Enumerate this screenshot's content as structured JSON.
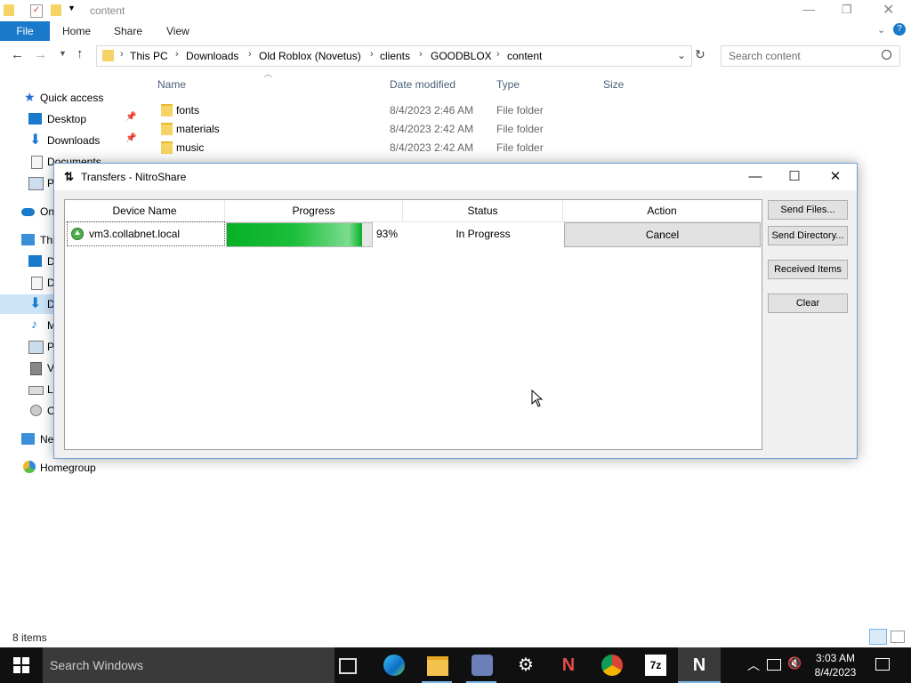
{
  "explorer": {
    "title": "content",
    "ribbon_tabs": [
      "File",
      "Home",
      "Share",
      "View"
    ],
    "breadcrumb": [
      "This PC",
      "Downloads",
      "Old Roblox (Novetus)",
      "clients",
      "GOODBLOX",
      "content"
    ],
    "search_placeholder": "Search content",
    "columns": {
      "name": "Name",
      "date": "Date modified",
      "type": "Type",
      "size": "Size"
    },
    "files": [
      {
        "name": "fonts",
        "date": "8/4/2023 2:46 AM",
        "type": "File folder"
      },
      {
        "name": "materials",
        "date": "8/4/2023 2:42 AM",
        "type": "File folder"
      },
      {
        "name": "music",
        "date": "8/4/2023 2:42 AM",
        "type": "File folder"
      }
    ],
    "nav": {
      "quick_access": "Quick access",
      "desktop": "Desktop",
      "downloads": "Downloads",
      "documents": "Documents",
      "pictures": "P",
      "onedrive": "On",
      "thispc": "Thi",
      "d1": "D",
      "d2": "D",
      "d3": "D",
      "music": "M",
      "pics2": "P",
      "videos": "V",
      "local": "Lo",
      "cd": "C",
      "network": "Ne",
      "homegroup": "Homegroup"
    },
    "status": "8 items"
  },
  "dialog": {
    "title": "Transfers - NitroShare",
    "headers": {
      "device": "Device Name",
      "progress": "Progress",
      "status": "Status",
      "action": "Action"
    },
    "transfer": {
      "device": "vm3.collabnet.local",
      "progress": 0.93,
      "progress_label": "93%",
      "status": "In Progress",
      "action": "Cancel"
    },
    "buttons": {
      "send_files": "Send Files...",
      "send_directory": "Send Directory...",
      "received": "Received Items",
      "clear": "Clear"
    }
  },
  "taskbar": {
    "search_placeholder": "Search Windows",
    "time": "3:03 AM",
    "date": "8/4/2023"
  }
}
